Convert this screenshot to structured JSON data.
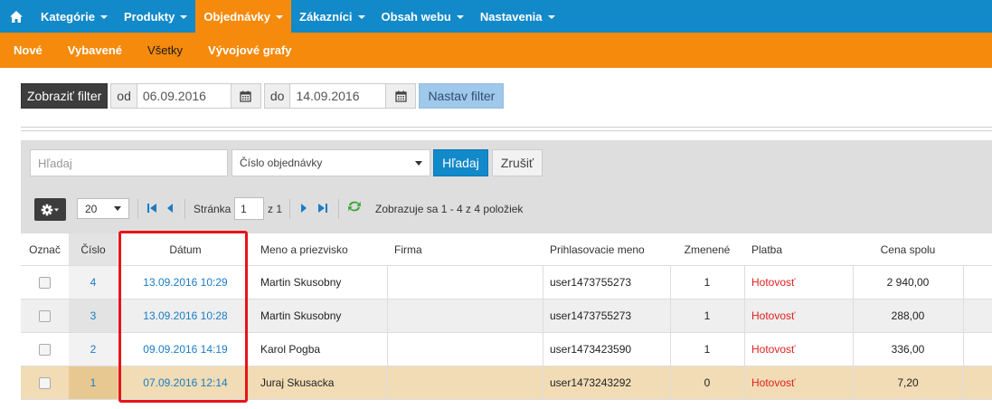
{
  "topnav": {
    "items": [
      {
        "label": "Kategórie"
      },
      {
        "label": "Produkty"
      },
      {
        "label": "Objednávky"
      },
      {
        "label": "Zákazníci"
      },
      {
        "label": "Obsah webu"
      },
      {
        "label": "Nastavenia"
      }
    ],
    "active_index": 2
  },
  "subnav": {
    "items": [
      {
        "label": "Nové"
      },
      {
        "label": "Vybavené"
      },
      {
        "label": "Všetky"
      },
      {
        "label": "Vývojové grafy"
      }
    ],
    "active_index": 2
  },
  "filter": {
    "show_filter_label": "Zobraziť filter",
    "from_label": "od",
    "from_value": "06.09.2016",
    "to_label": "do",
    "to_value": "14.09.2016",
    "apply_label": "Nastav filter"
  },
  "search": {
    "placeholder": "Hľadaj",
    "field_select": "Číslo objednávky",
    "search_label": "Hľadaj",
    "cancel_label": "Zrušiť"
  },
  "pager": {
    "page_size": "20",
    "page_label": "Stránka",
    "page_value": "1",
    "of_label": "z 1",
    "info": "Zobrazuje sa 1 - 4 z 4 položiek"
  },
  "table": {
    "headers": {
      "mark": "Označ",
      "number": "Číslo",
      "date": "Dátum",
      "name": "Meno a priezvisko",
      "company": "Firma",
      "login": "Prihlasovacie meno",
      "changed": "Zmenené",
      "payment": "Platba",
      "total": "Cena spolu"
    },
    "rows": [
      {
        "number": "4",
        "date": "13.09.2016 10:29",
        "name": "Martin Skusobny",
        "company": "",
        "login": "user1473755273",
        "changed": "1",
        "payment": "Hotovosť",
        "total": "2 940,00"
      },
      {
        "number": "3",
        "date": "13.09.2016 10:28",
        "name": "Martin Skusobny",
        "company": "",
        "login": "user1473755273",
        "changed": "1",
        "payment": "Hotovosť",
        "total": "288,00"
      },
      {
        "number": "2",
        "date": "09.09.2016 14:19",
        "name": "Karol Pogba",
        "company": "",
        "login": "user1473423590",
        "changed": "1",
        "payment": "Hotovosť",
        "total": "336,00"
      },
      {
        "number": "1",
        "date": "07.09.2016 12:14",
        "name": "Juraj Skusacka",
        "company": "",
        "login": "user1473243292",
        "changed": "0",
        "payment": "Hotovosť",
        "total": "7,20"
      }
    ]
  },
  "colors": {
    "nav_blue": "#1289c9",
    "nav_orange": "#f58a0c",
    "link_blue": "#1a7cc4",
    "payment_red": "#e02020",
    "selected_row": "#f1dcb5",
    "highlight_border": "#e8141b"
  },
  "icons": {
    "home": "home-icon",
    "calendar": "calendar-icon",
    "gear": "gear-icon",
    "first_page": "first-page-icon",
    "prev_page": "prev-page-icon",
    "next_page": "next-page-icon",
    "last_page": "last-page-icon",
    "refresh": "refresh-icon"
  }
}
